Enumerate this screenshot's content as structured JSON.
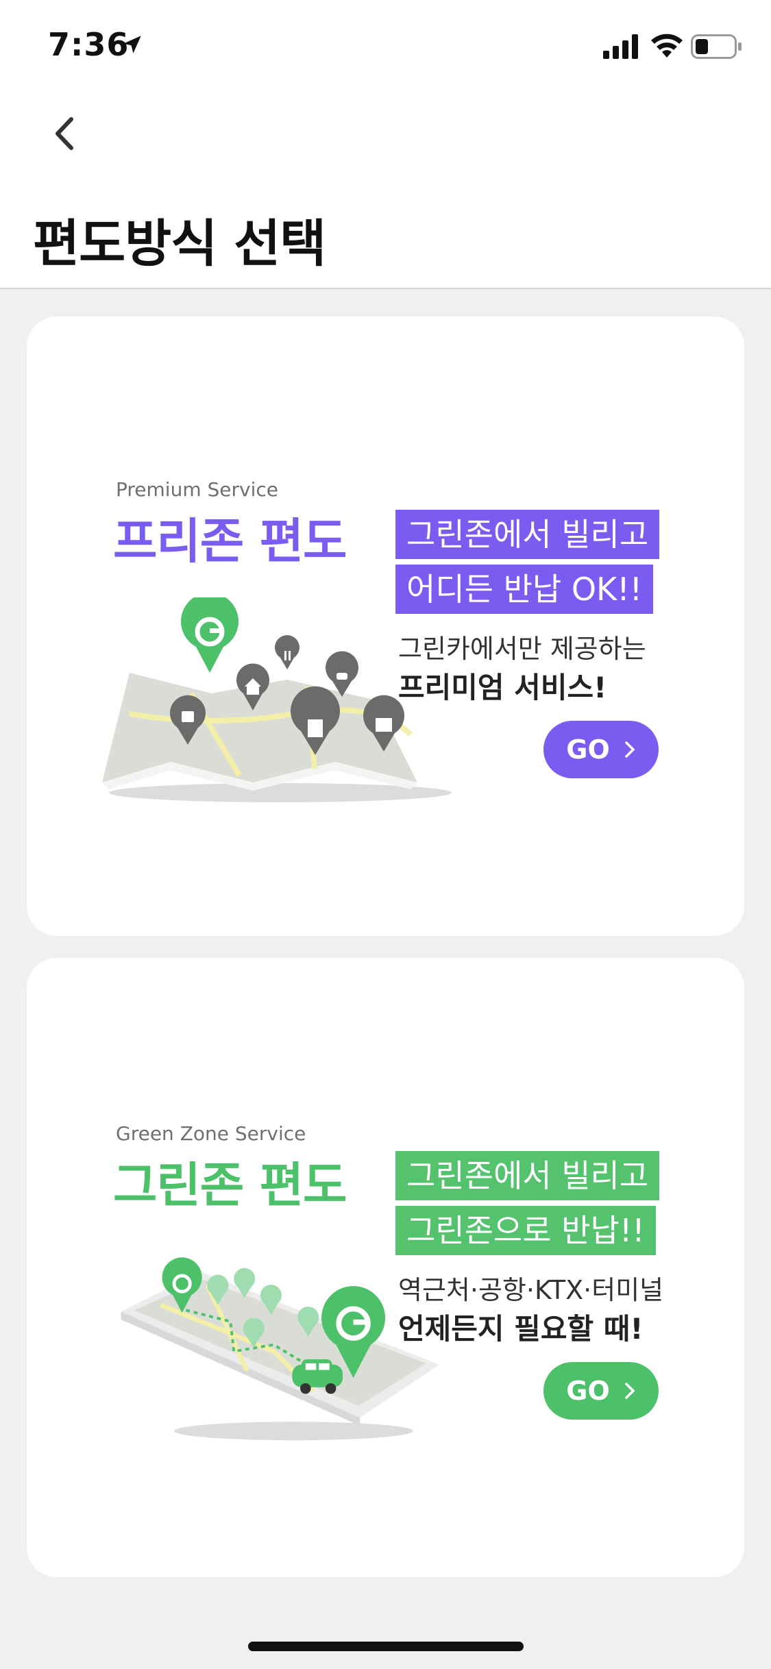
{
  "status_bar": {
    "time": "7:36"
  },
  "header": {
    "title": "편도방식 선택"
  },
  "colors": {
    "purple": "#7b5cf0",
    "green": "#4cc16a",
    "green_tag": "#55c26d"
  },
  "cards": [
    {
      "subtitle": "Premium Service",
      "title": "프리존 편도",
      "tag1": "그린존에서 빌리고",
      "tag2": "어디든 반납 OK!!",
      "desc1": "그린카에서만 제공하는",
      "desc2": "프리미엄 서비스!",
      "go_label": "GO"
    },
    {
      "subtitle": "Green Zone Service",
      "title": "그린존 편도",
      "tag1": "그린존에서 빌리고",
      "tag2": "그린존으로 반납!!",
      "desc1": "역근처·공항·KTX·터미널",
      "desc2": "언제든지 필요할 때!",
      "go_label": "GO"
    }
  ]
}
